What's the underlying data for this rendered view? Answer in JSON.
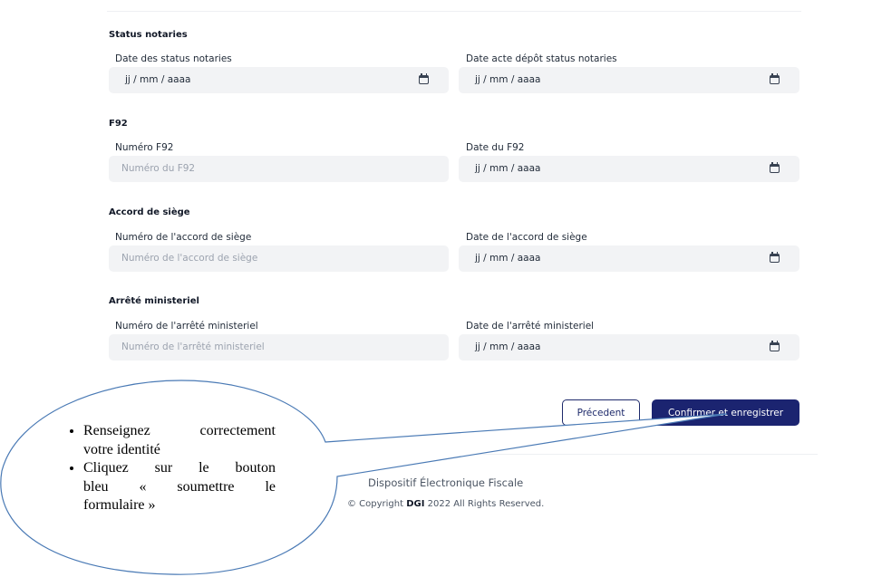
{
  "sections": [
    {
      "title": "Status notaries",
      "left": {
        "label": "Date des status notaries",
        "type": "date",
        "value": "jj / mm / aaaa"
      },
      "right": {
        "label": "Date acte dépôt status notaries",
        "type": "date",
        "value": "jj / mm / aaaa"
      }
    },
    {
      "title": "F92",
      "left": {
        "label": "Numéro F92",
        "type": "text",
        "placeholder": "Numéro du F92"
      },
      "right": {
        "label": "Date du F92",
        "type": "date",
        "value": "jj / mm / aaaa"
      }
    },
    {
      "title": "Accord de siège",
      "left": {
        "label": "Numéro de l'accord de siège",
        "type": "text",
        "placeholder": "Numéro de l'accord de siège"
      },
      "right": {
        "label": "Date de l'accord de siège",
        "type": "date",
        "value": "jj / mm / aaaa"
      }
    },
    {
      "title": "Arrêté ministeriel",
      "left": {
        "label": "Numéro de l'arrêté ministeriel",
        "type": "text",
        "placeholder": "Numéro de l'arrêté ministeriel"
      },
      "right": {
        "label": "Date de l'arrêté ministeriel",
        "type": "date",
        "value": "jj / mm / aaaa"
      }
    }
  ],
  "actions": {
    "previous_label": "Précedent",
    "confirm_label": "Confirmer et enregistrer",
    "confirm_color": "#1b2470"
  },
  "footer": {
    "line1": "Dispositif Électronique Fiscale",
    "copyright_prefix": "© Copyright ",
    "copyright_brand": "DGI",
    "copyright_suffix": " 2022 All Rights Reserved."
  },
  "callout": {
    "items": [
      "Renseignez correctement votre identité",
      "Cliquez sur le bouton bleu « soumettre le formulaire »"
    ],
    "item1_line1": "Renseignez correctement",
    "item1_line2": "votre identité",
    "item2_line1": "Cliquez sur le bouton",
    "item2_line2": "bleu « soumettre le",
    "item2_line3": "formulaire »"
  }
}
